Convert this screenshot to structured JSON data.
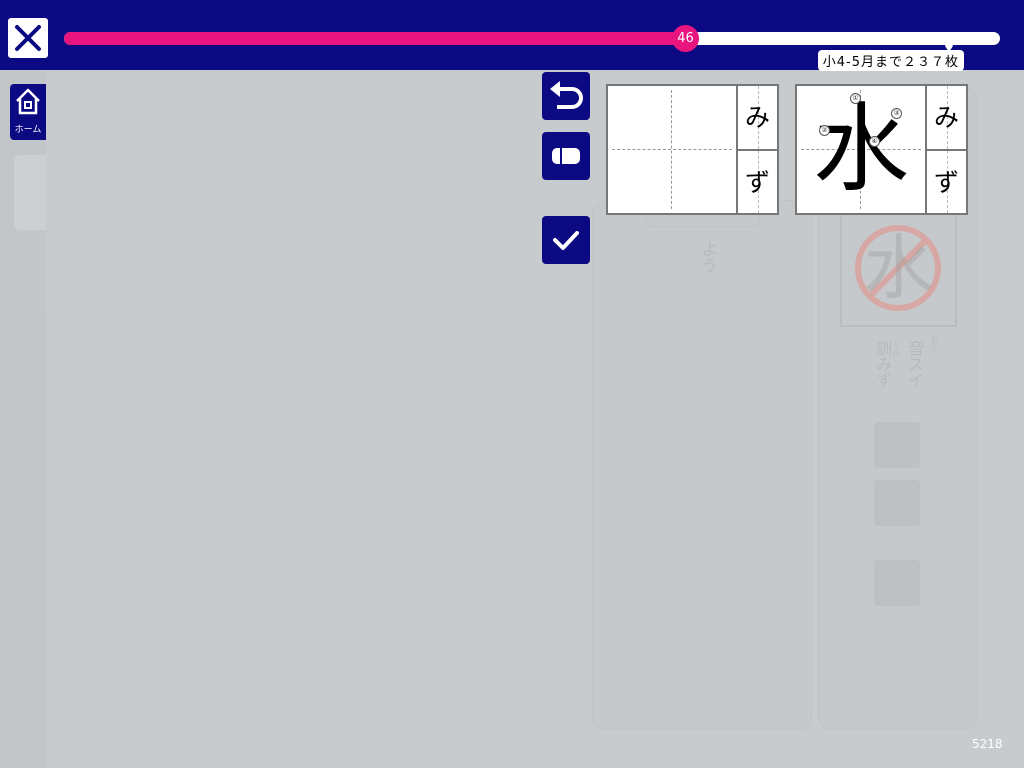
{
  "header": {
    "progress_value": "46",
    "progress_fraction": 0.663,
    "goal_label": "小4-5月まで２３７枚",
    "colors": {
      "bar_bg": "#0c0a83",
      "fill": "#e8157f",
      "track": "#ffffff"
    }
  },
  "nav": {
    "close_icon": "close-x-icon",
    "home_label": "ホーム",
    "home_icon": "house-icon"
  },
  "tools": {
    "undo_icon": "undo-arrow-icon",
    "eraser_icon": "eraser-icon",
    "check_icon": "checkmark-icon"
  },
  "practice_card": {
    "reading": [
      "み",
      "ず"
    ]
  },
  "model_card": {
    "kanji": "水",
    "reading": [
      "み",
      "ず"
    ],
    "stroke_numbers": [
      "①",
      "②",
      "③",
      "④"
    ]
  },
  "background_panel": {
    "kanji": "水",
    "on_label": "音",
    "on_reading": "スイ",
    "on_ruby": "おん",
    "kun_label": "訓",
    "kun_reading": "みず",
    "kun_ruby": "くん",
    "left_ghost_text": "よう"
  },
  "footer": {
    "page_number": "5218"
  }
}
